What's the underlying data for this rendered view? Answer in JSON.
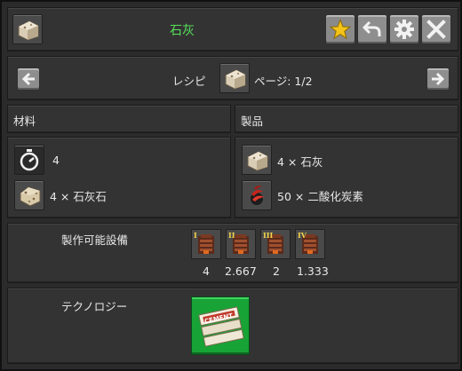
{
  "header": {
    "title": "石灰",
    "title_color": "#55e05a",
    "buttons": [
      "star-icon",
      "back-arrow-icon",
      "gear-icon",
      "close-icon"
    ]
  },
  "nav": {
    "label_recipe": "レシピ",
    "label_page": "ページ: 1/2"
  },
  "ingredients": {
    "heading": "材料",
    "time_value": "4",
    "items": [
      {
        "text": "4 × 石灰石"
      }
    ]
  },
  "products": {
    "heading": "製品",
    "items": [
      {
        "text": "4 × 石灰"
      },
      {
        "text": "50 × 二酸化炭素"
      }
    ]
  },
  "machines": {
    "label": "製作可能設備",
    "tiers": [
      {
        "roman": "I",
        "speed": "4"
      },
      {
        "roman": "II",
        "speed": "2.667"
      },
      {
        "roman": "III",
        "speed": "2"
      },
      {
        "roman": "IV",
        "speed": "1.333"
      }
    ]
  },
  "technology": {
    "label": "テクノロジー",
    "tech_text": "CEMENT",
    "tech_color": "#1aa83a"
  }
}
